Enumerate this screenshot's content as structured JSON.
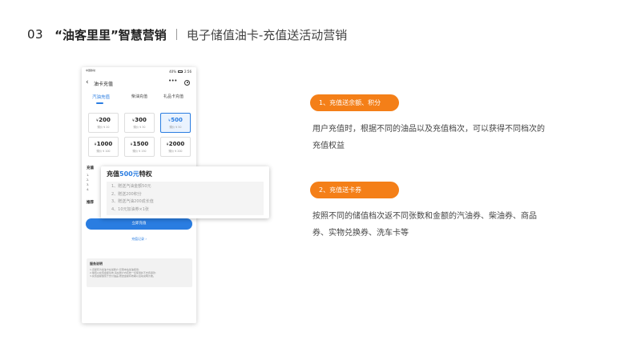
{
  "slide": {
    "number": "03",
    "title": "“油客里里”智慧营销",
    "subtitle": "电子储值油卡-充值送活动营销"
  },
  "phone": {
    "status": {
      "carrier": "中国移动",
      "battery": "40%",
      "time": "2:56"
    },
    "nav": {
      "back_icon": "‹",
      "title": "油卡充值",
      "more_icon": "•••"
    },
    "tabs": [
      {
        "label": "汽油充值",
        "active": true
      },
      {
        "label": "柴油充值",
        "active": false
      },
      {
        "label": "礼品卡充值",
        "active": false
      }
    ],
    "amounts": [
      {
        "value": "200",
        "gift": "赠价 ¥ 20",
        "selected": false
      },
      {
        "value": "300",
        "gift": "赠价 ¥ 30",
        "selected": false
      },
      {
        "value": "500",
        "gift": "赠价 ¥ 50",
        "selected": true
      },
      {
        "value": "1000",
        "gift": "赠价 ¥ 100",
        "selected": false
      },
      {
        "value": "1500",
        "gift": "赠价 ¥ 150",
        "selected": false
      },
      {
        "value": "2000",
        "gift": "赠价 ¥ 200",
        "selected": false
      }
    ],
    "currency_symbol": "¥",
    "privilege_stub": {
      "heading": "充值",
      "lines": [
        "1.",
        "2.",
        "3.",
        "4."
      ]
    },
    "recommend_stub": "推荐",
    "pay_button": "立即充值",
    "record_link": "充值记录 ›",
    "service": {
      "title": "服务说明",
      "lines": [
        "1.该额有为加油卡在加账户,仅限本站加油使用;",
        "2.储值以充值金额生效,请在账户内有效一切使用并不支持退款;",
        "3.充值金额储值于支付油品,赠送金额有效期以活动说明为准。"
      ]
    }
  },
  "privilege_card": {
    "title_prefix": "充值",
    "title_highlight": "500元",
    "title_suffix": "特权",
    "items": [
      "1、赠送汽油金额50元",
      "2、赠送200积分",
      "3、赠送汽油200成长值",
      "4、10元加油券×1张"
    ]
  },
  "features": [
    {
      "pill": "1、充值送余额、积分",
      "description": "用户充值时，根据不同的油品以及充值档次，可以获得不同档次的充值权益"
    },
    {
      "pill": "2、充值送卡券",
      "description": "按照不同的储值档次返不同张数和金额的汽油券、柴油券、商品券、实物兑换券、洗车卡等"
    }
  ],
  "colors": {
    "accent_blue": "#2a7de1",
    "pill_orange": "#f47f18"
  }
}
